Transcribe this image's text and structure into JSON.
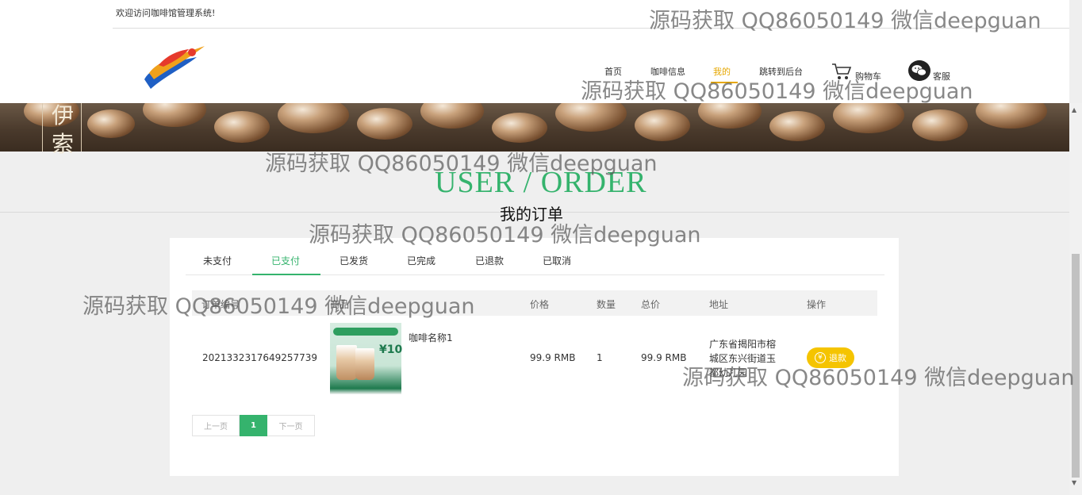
{
  "header": {
    "welcome": "欢迎访问咖啡馆管理系统!",
    "nav": [
      {
        "label": "首页",
        "active": false
      },
      {
        "label": "咖啡信息",
        "active": false
      },
      {
        "label": "我的",
        "active": true
      },
      {
        "label": "跳转到后台",
        "active": false
      }
    ],
    "cart_label": "购物车",
    "service_label": "客服",
    "accent_color": "#e6a700"
  },
  "banner": {
    "text": "伊索"
  },
  "section": {
    "title": "USER / ORDER",
    "subtitle": "我的订单",
    "title_color": "#35b36d"
  },
  "tabs": [
    {
      "label": "未支付",
      "active": false
    },
    {
      "label": "已支付",
      "active": true
    },
    {
      "label": "已发货",
      "active": false
    },
    {
      "label": "已完成",
      "active": false
    },
    {
      "label": "已退款",
      "active": false
    },
    {
      "label": "已取消",
      "active": false
    }
  ],
  "table": {
    "headers": [
      "订单编号",
      "商品",
      "价格",
      "数量",
      "总价",
      "地址",
      "操作"
    ],
    "rows": [
      {
        "order_no": "2021332317649257739",
        "product_name": "咖啡名称1",
        "price": "99.9 RMB",
        "quantity": "1",
        "total": "99.9 RMB",
        "address": "广东省揭阳市榕城区东兴街道玉都幼儿园",
        "action_label": "退款",
        "action_icon": "yen-icon"
      }
    ]
  },
  "product_image": {
    "price_text": "¥10"
  },
  "pagination": {
    "prev": "上一页",
    "current": "1",
    "next": "下一页"
  },
  "watermark": "源码获取 QQ86050149 微信deepguan"
}
